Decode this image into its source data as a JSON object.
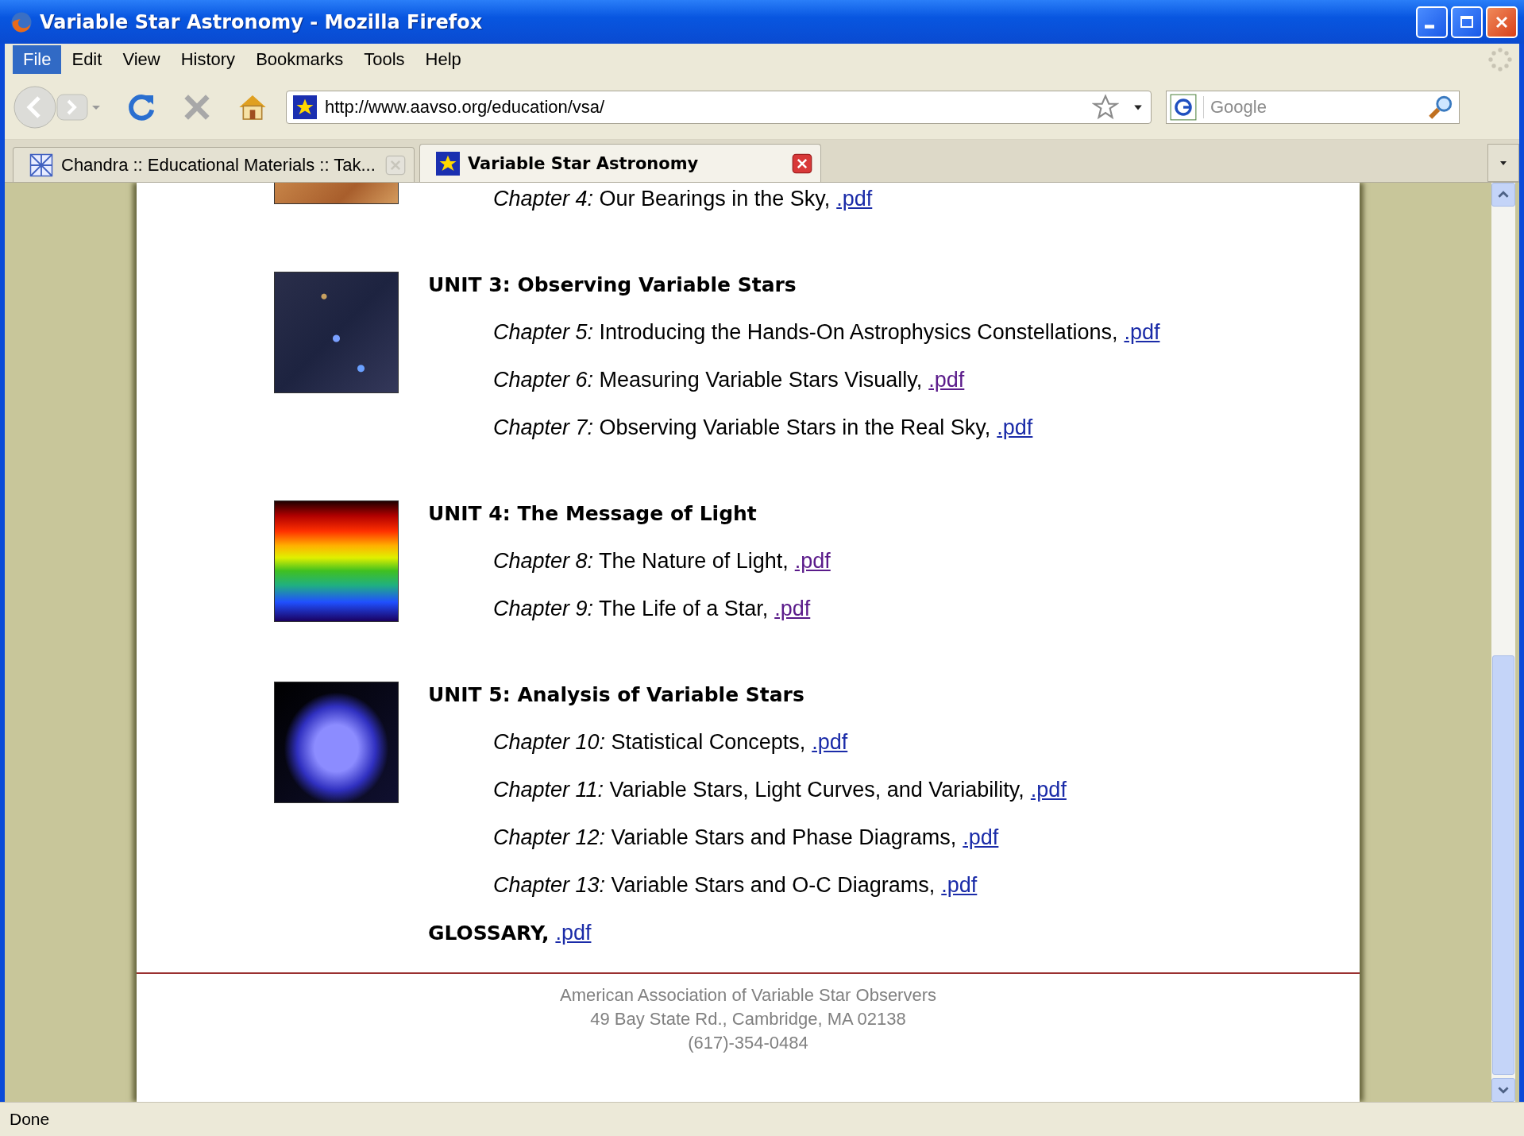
{
  "window": {
    "title": "Variable Star Astronomy - Mozilla Firefox"
  },
  "menu": [
    {
      "label": "File",
      "selected": true
    },
    {
      "label": "Edit",
      "selected": false
    },
    {
      "label": "View",
      "selected": false
    },
    {
      "label": "History",
      "selected": false
    },
    {
      "label": "Bookmarks",
      "selected": false
    },
    {
      "label": "Tools",
      "selected": false
    },
    {
      "label": "Help",
      "selected": false
    }
  ],
  "toolbar": {
    "url": "http://www.aavso.org/education/vsa/",
    "search": {
      "placeholder": "Google"
    }
  },
  "tabs": [
    {
      "label": "Chandra :: Educational Materials :: Tak...",
      "selected": false
    },
    {
      "label": "Variable Star Astronomy",
      "selected": true
    }
  ],
  "units": [
    {
      "chapters": [
        {
          "label": "Chapter 4:",
          "title": "Our Bearings in the Sky,",
          "link": ".pdf",
          "visited": false
        }
      ]
    },
    {
      "title": "UNIT 3: Observing Variable Stars",
      "chapters": [
        {
          "label": "Chapter 5:",
          "title": "Introducing the Hands-On Astrophysics Constellations,",
          "link": ".pdf",
          "visited": false
        },
        {
          "label": "Chapter 6:",
          "title": "Measuring Variable Stars Visually,",
          "link": ".pdf",
          "visited": true
        },
        {
          "label": "Chapter 7:",
          "title": "Observing Variable Stars in the Real Sky,",
          "link": ".pdf",
          "visited": false
        }
      ]
    },
    {
      "title": "UNIT 4: The Message of Light",
      "chapters": [
        {
          "label": "Chapter 8:",
          "title": "The Nature of Light,",
          "link": ".pdf",
          "visited": true
        },
        {
          "label": "Chapter 9:",
          "title": "The Life of a Star,",
          "link": ".pdf",
          "visited": true
        }
      ]
    },
    {
      "title": "UNIT 5: Analysis of Variable Stars",
      "chapters": [
        {
          "label": "Chapter 10:",
          "title": "Statistical Concepts,",
          "link": ".pdf",
          "visited": false
        },
        {
          "label": "Chapter 11:",
          "title": "Variable Stars, Light Curves, and Variability,",
          "link": ".pdf",
          "visited": false
        },
        {
          "label": "Chapter 12:",
          "title": "Variable Stars and Phase Diagrams,",
          "link": ".pdf",
          "visited": false
        },
        {
          "label": "Chapter 13:",
          "title": "Variable Stars and O-C Diagrams,",
          "link": ".pdf",
          "visited": false
        }
      ]
    }
  ],
  "glossary": {
    "label": "GLOSSARY,",
    "link": ".pdf",
    "visited": false
  },
  "footer": [
    "American Association of Variable Star Observers",
    "49 Bay State Rd., Cambridge, MA 02138",
    "(617)-354-0484"
  ],
  "status_bar": {
    "text": "Done"
  }
}
